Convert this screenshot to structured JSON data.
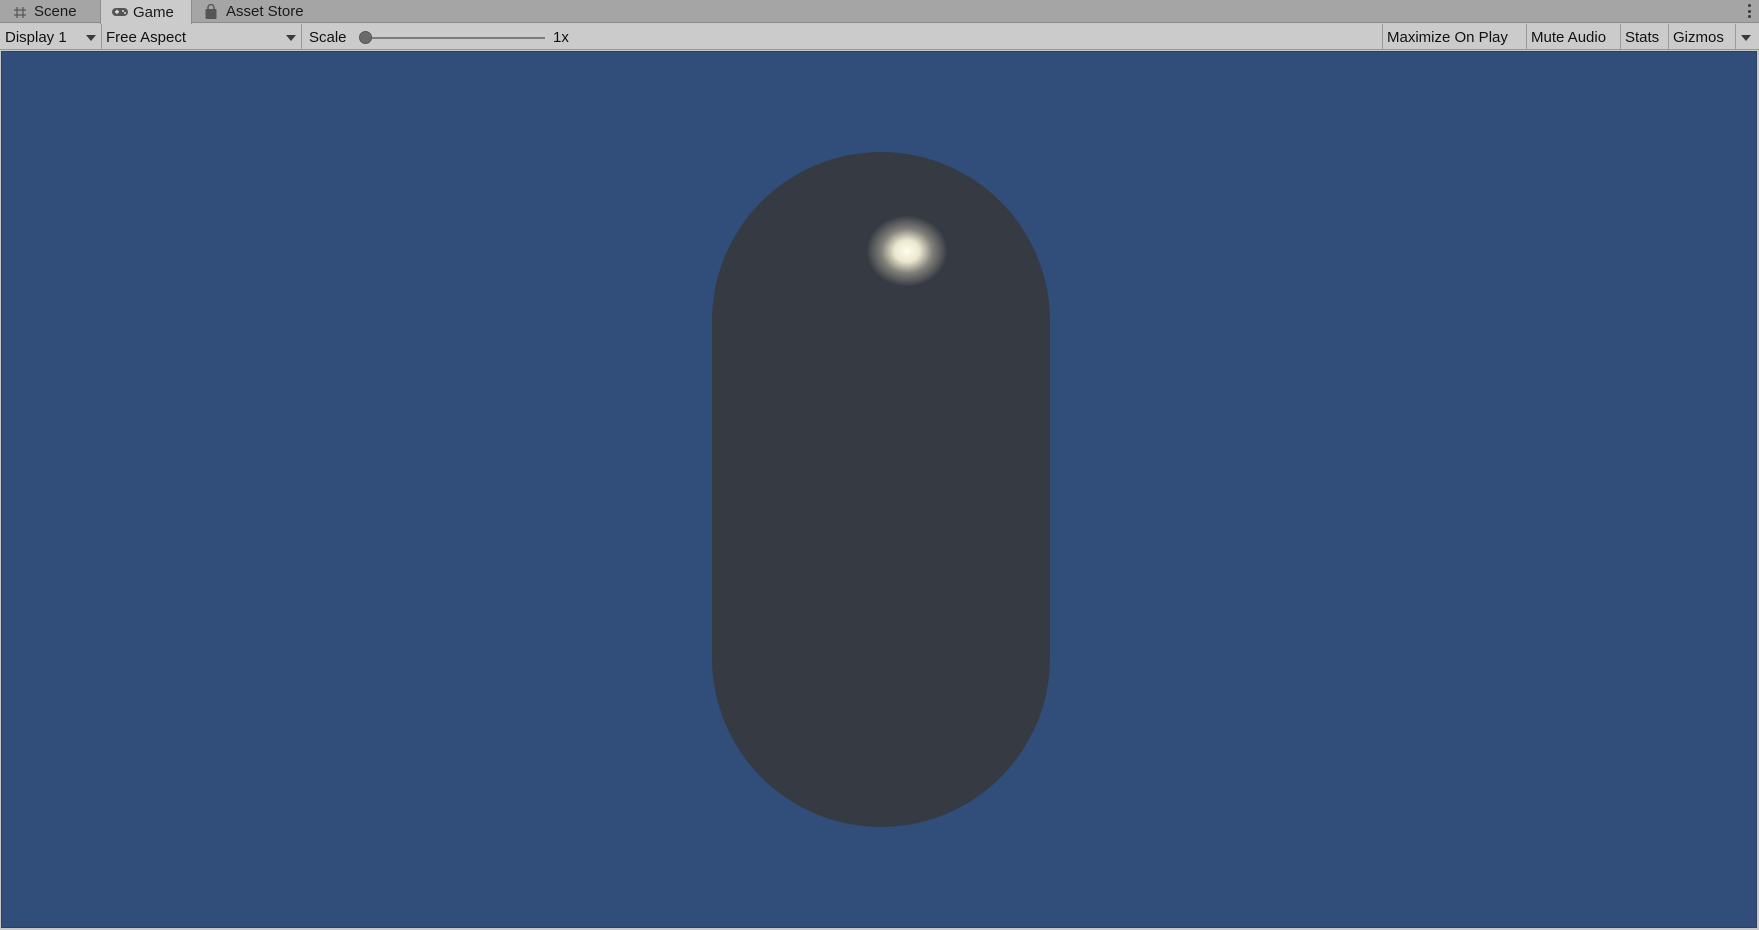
{
  "tabs": [
    {
      "label": "Scene",
      "icon": "grid-icon",
      "active": false
    },
    {
      "label": "Game",
      "icon": "gamepad-icon",
      "active": true
    },
    {
      "label": "Asset Store",
      "icon": "shopping-bag-icon",
      "active": false
    }
  ],
  "toolbar": {
    "display_value": "Display 1",
    "aspect_value": "Free Aspect",
    "scale_label": "Scale",
    "scale_value": "1x",
    "maximize_label": "Maximize On Play",
    "mute_label": "Mute Audio",
    "stats_label": "Stats",
    "gizmos_label": "Gizmos"
  },
  "viewport": {
    "background_color": "#314d79",
    "object": "capsule",
    "object_color": "#363a43",
    "highlight_color": "#fffdee"
  }
}
